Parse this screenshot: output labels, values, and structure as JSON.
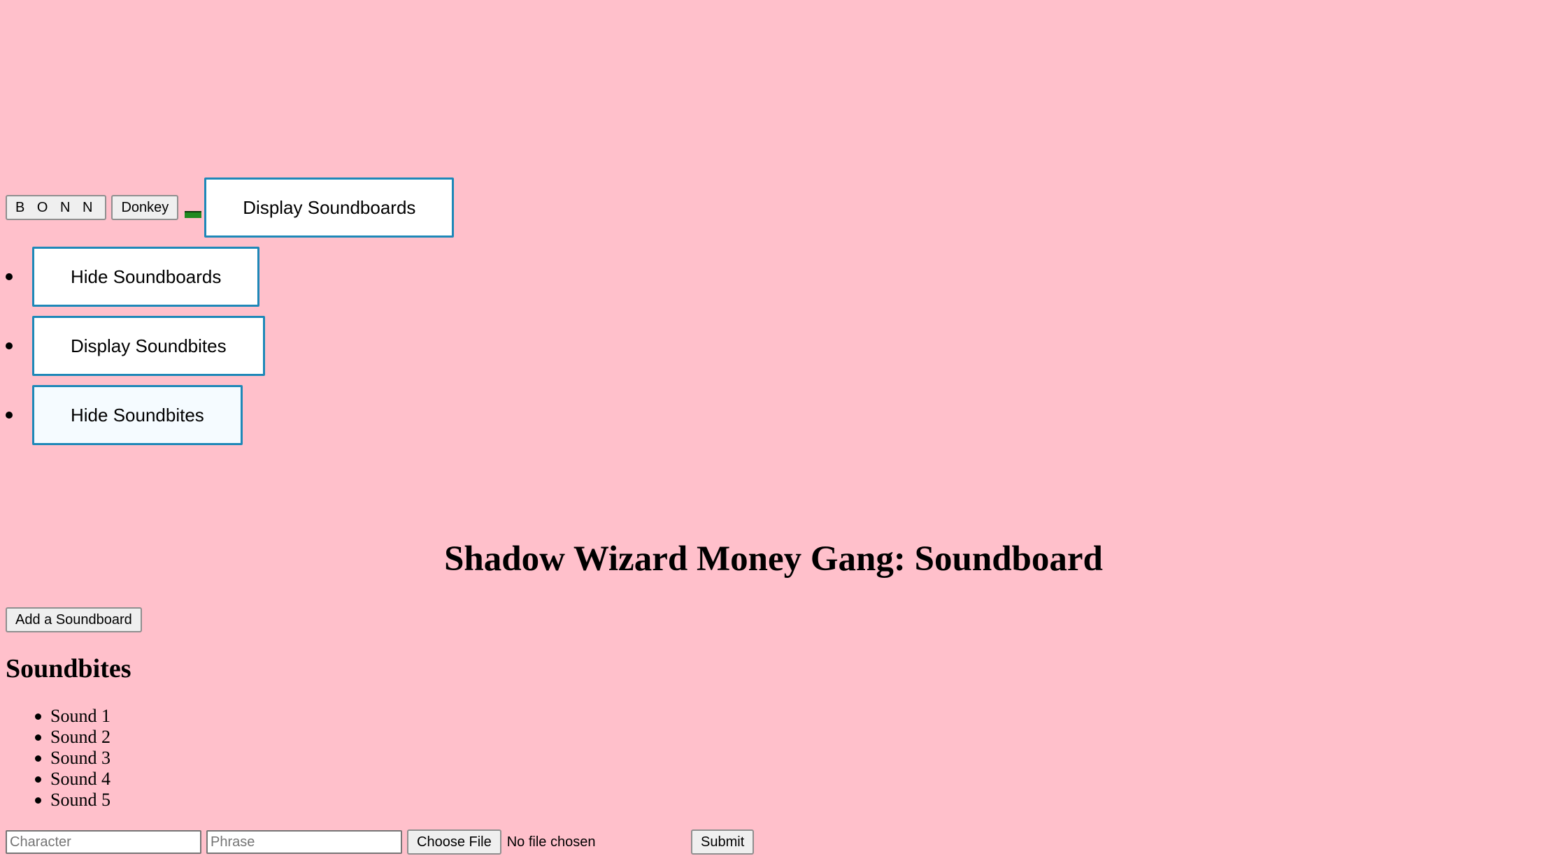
{
  "toolbar": {
    "bonn_label": "B O N N",
    "donkey_label": "Donkey",
    "display_soundboards_label": "Display Soundboards"
  },
  "menu": {
    "items": [
      {
        "label": "Hide Soundboards"
      },
      {
        "label": "Display Soundbites"
      },
      {
        "label": "Hide Soundbites"
      }
    ]
  },
  "page": {
    "title": "Shadow Wizard Money Gang: Soundboard",
    "add_soundboard_label": "Add a Soundboard"
  },
  "soundbites": {
    "heading": "Soundbites",
    "items": [
      "Sound 1",
      "Sound 2",
      "Sound 3",
      "Sound 4",
      "Sound 5"
    ]
  },
  "form": {
    "character_placeholder": "Character",
    "phrase_placeholder": "Phrase",
    "choose_file_label": "Choose File",
    "file_status": "No file chosen",
    "submit_label": "Submit"
  },
  "colors": {
    "background": "#ffc0cb",
    "accent_border": "#1e88b8"
  }
}
